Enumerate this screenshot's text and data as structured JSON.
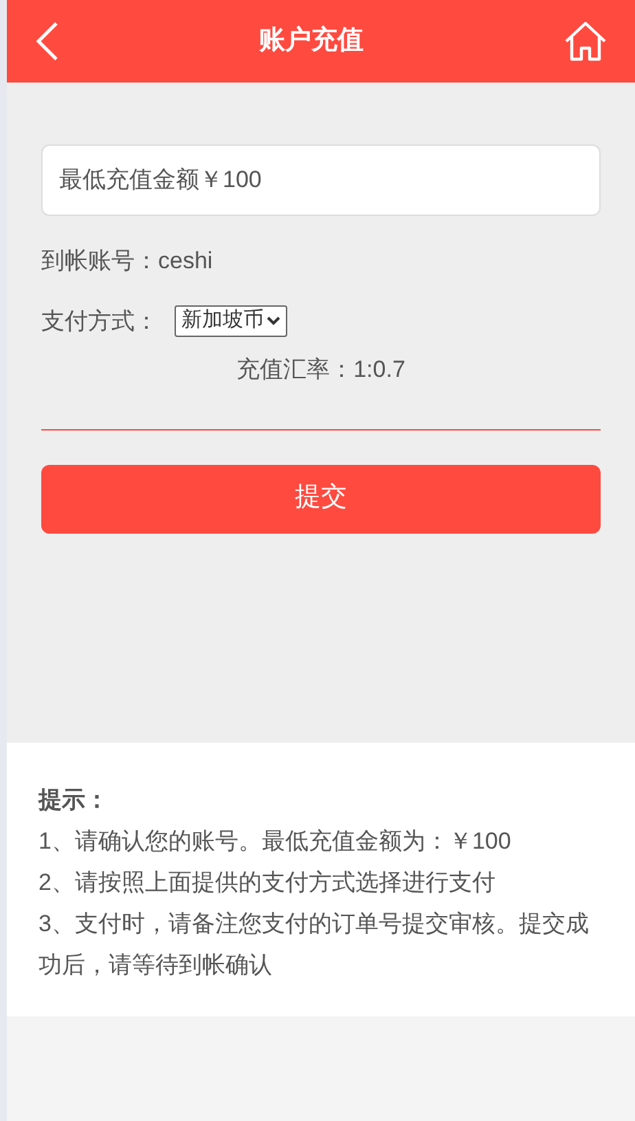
{
  "header": {
    "title": "账户充值"
  },
  "amount_field": {
    "placeholder": "最低充值金额￥100"
  },
  "account": {
    "label": "到帐账号：",
    "value": "ceshi"
  },
  "payment": {
    "label": "支付方式：",
    "selected_option": "新加坡币"
  },
  "rate": "充值汇率：1:0.7",
  "submit_button": "提交",
  "tips": {
    "title": "提示：",
    "lines": [
      "1、请确认您的账号。最低充值金额为：￥100",
      "2、请按照上面提供的支付方式选择进行支付",
      "3、支付时，请备注您支付的订单号提交审核。提交成功后，请等待到帐确认"
    ]
  }
}
